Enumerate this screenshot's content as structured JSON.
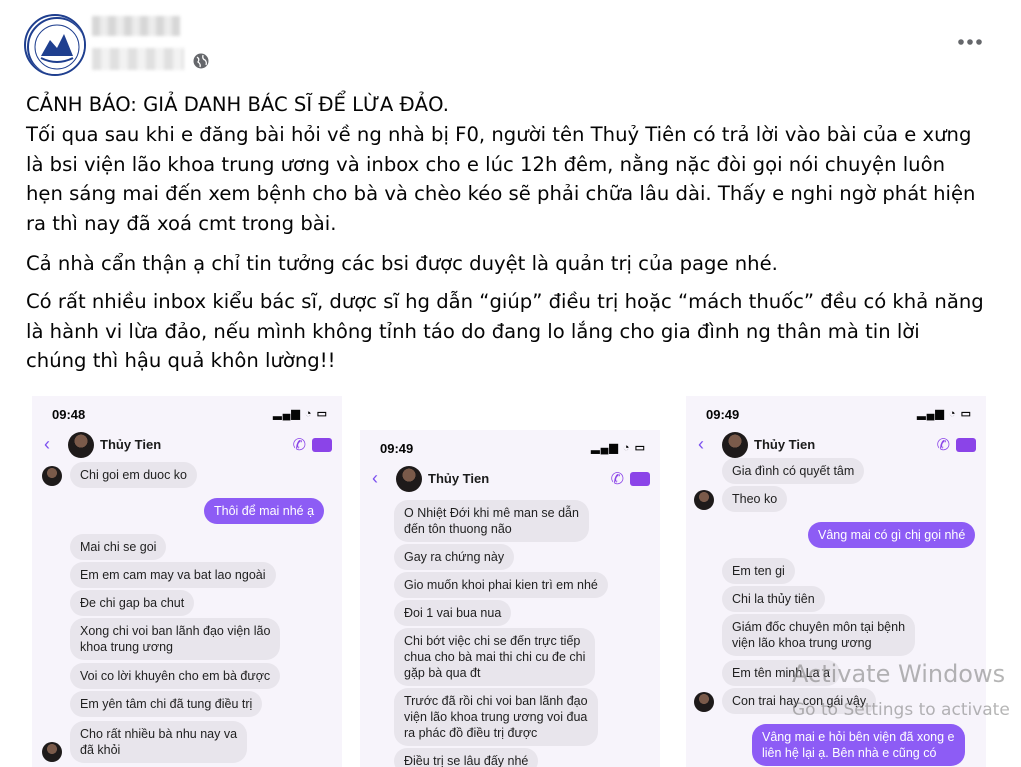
{
  "post": {
    "paragraphs": [
      [
        "CẢNH BÁO: GIẢ DANH BÁC SĨ ĐỂ LỪA ĐẢO.",
        "Tối qua sau khi e đăng bài hỏi về ng nhà bị F0, người tên Thuỷ Tiên có trả lời vào bài của e xưng",
        "là bsi viện lão khoa trung ương và inbox cho e lúc 12h đêm, nằng nặc đòi gọi nói chuyện luôn",
        "hẹn sáng mai đến xem bệnh cho bà và chèo kéo sẽ phải chữa lâu dài. Thấy e nghi ngờ phát hiện",
        "ra thì nay đã xoá cmt trong bài."
      ],
      [
        "Cả nhà cẩn thận ạ chỉ tin tưởng các bsi được duyệt là quản trị của page nhé."
      ],
      [
        "Có rất nhiều inbox kiểu bác sĩ, dược sĩ hg dẫn “giúp” điều trị hoặc “mách thuốc” đều có khả năng",
        "là hành vi lừa đảo, nếu mình không tỉnh táo do đang lo lắng cho gia đình ng thân mà tin lời",
        "chúng thì hậu quả khôn lường!!"
      ]
    ]
  },
  "icons": {
    "privacy": "globe-icon",
    "menu": "more-options-icon"
  },
  "screens": [
    {
      "time": "09:48",
      "contact": "Thủy Tien",
      "messages": [
        {
          "text": "Chi goi em duoc ko",
          "me": false
        },
        {
          "text": "Thôi để mai nhé ạ",
          "me": true
        },
        {
          "text": "Mai chi se goi",
          "me": false
        },
        {
          "text": "Em em cam may va bat lao ngoài",
          "me": false
        },
        {
          "text": "Đe chi gap ba chut",
          "me": false
        },
        {
          "text": "Xong chi voi ban lãnh đạo viện lão\nkhoa trung ương",
          "me": false
        },
        {
          "text": "Voi co lời khuyên cho em bà được",
          "me": false
        },
        {
          "text": "Em yên tâm chi đã tung điều trị",
          "me": false
        },
        {
          "text": "Cho rất nhiều bà nhu nay va\nđã khỏi",
          "me": false
        }
      ]
    },
    {
      "time": "09:49",
      "contact": "Thủy Tien",
      "messages": [
        {
          "text": "O Nhiệt Đới khi mê man se dẫn\nđến tôn thuong não",
          "me": false
        },
        {
          "text": "Gay ra chứng này",
          "me": false
        },
        {
          "text": "Gio muốn khoi phai kien trì em nhé",
          "me": false
        },
        {
          "text": "Đoi 1 vai bua nua",
          "me": false
        },
        {
          "text": "Chi bớt việc chi se đến trực tiếp\nchua cho bà mai thi chi cu đe chi\ngặp bà qua đt",
          "me": false
        },
        {
          "text": "Trước đã rồi chi voi ban lãnh đạo\nviện lão khoa trung ương voi đua\nra phác đồ điều trị được",
          "me": false
        },
        {
          "text": "Điều trị se lâu đấy nhé",
          "me": false
        }
      ]
    },
    {
      "time": "09:49",
      "contact": "Thủy Tien",
      "messages": [
        {
          "text": "Gia đình có quyết tâm",
          "me": false
        },
        {
          "text": "Theo ko",
          "me": false
        },
        {
          "text": "Vâng mai có gì chị gọi nhé",
          "me": true
        },
        {
          "text": "Em ten gi",
          "me": false
        },
        {
          "text": "Chi la thủy tiên",
          "me": false
        },
        {
          "text": "Giám đốc chuyên môn tại bệnh\nviện lão khoa trung ương",
          "me": false
        },
        {
          "text": "Em tên minh La a",
          "me": false
        },
        {
          "text": "Con trai hay con gái vậy",
          "me": false
        },
        {
          "text": "Vâng mai e hỏi bên viện đã xong e\nliên hệ lại ạ. Bên nhà e cũng có",
          "me": true
        }
      ]
    }
  ],
  "watermark": {
    "line1": "Activate Windows",
    "line2": "Go to Settings to activate"
  }
}
